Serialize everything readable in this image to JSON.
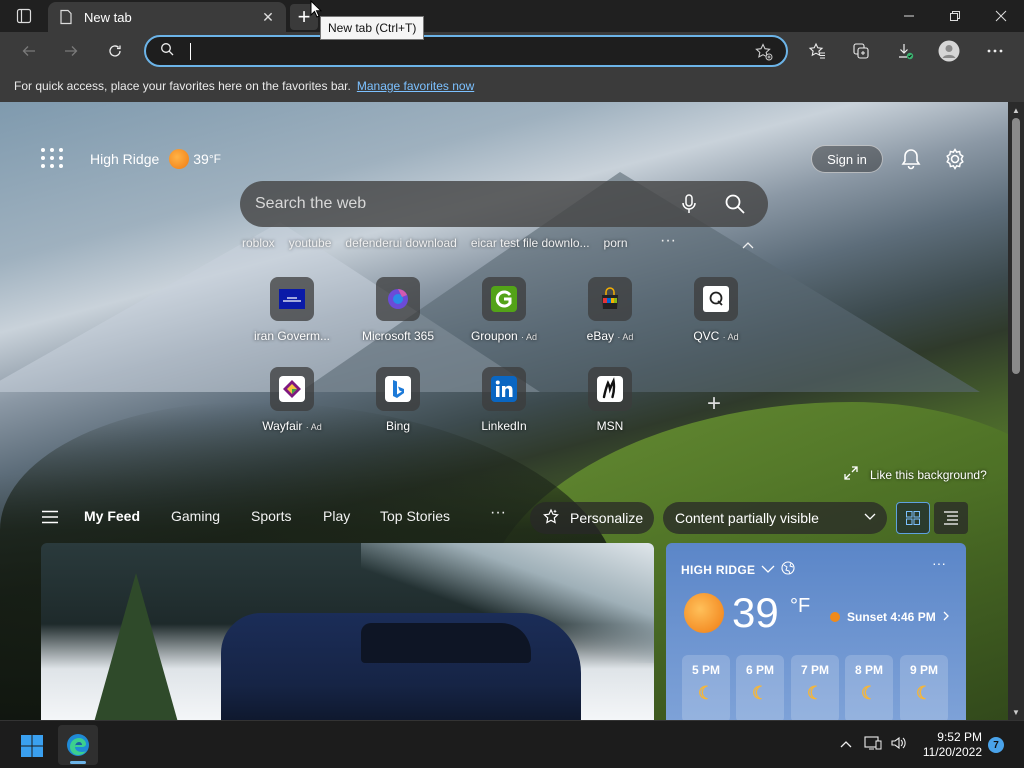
{
  "browser": {
    "tab": {
      "title": "New tab",
      "close": "✕"
    },
    "new_tab_tooltip": "New tab (Ctrl+T)",
    "address": {
      "value": "",
      "placeholder": ""
    },
    "favorites_bar": {
      "message": "For quick access, place your favorites here on the favorites bar.",
      "link": "Manage favorites now"
    }
  },
  "newtab": {
    "location": "High Ridge",
    "temp": "39",
    "temp_unit": "°F",
    "sign_in": "Sign in",
    "search_placeholder": "Search the web",
    "suggestions": [
      "roblox",
      "youtube",
      "defenderui download",
      "eicar test file downlo...",
      "porn"
    ],
    "tiles": [
      {
        "label": "iran Goverm...",
        "ad": ""
      },
      {
        "label": "Microsoft 365",
        "ad": ""
      },
      {
        "label": "Groupon",
        "ad": "Ad"
      },
      {
        "label": "eBay",
        "ad": "Ad"
      },
      {
        "label": "QVC",
        "ad": "Ad"
      },
      {
        "label": "Wayfair",
        "ad": "Ad"
      },
      {
        "label": "Bing",
        "ad": ""
      },
      {
        "label": "LinkedIn",
        "ad": ""
      },
      {
        "label": "MSN",
        "ad": ""
      }
    ],
    "like_background": "Like this background?",
    "feed_tabs": [
      "My Feed",
      "Gaming",
      "Sports",
      "Play",
      "Top Stories"
    ],
    "personalize": "Personalize",
    "content_visibility": "Content partially visible",
    "weather": {
      "location": "HIGH RIDGE",
      "temp": "39",
      "unit": "°F",
      "sunset": "Sunset 4:46 PM",
      "hours": [
        "5 PM",
        "6 PM",
        "7 PM",
        "8 PM",
        "9 PM"
      ]
    }
  },
  "taskbar": {
    "time": "9:52 PM",
    "date": "11/20/2022",
    "notifications": "7"
  },
  "colors": {
    "accent": "#6cb4e8",
    "tab_bg": "#3b3b3b",
    "weather_card": "#5b86c8"
  }
}
